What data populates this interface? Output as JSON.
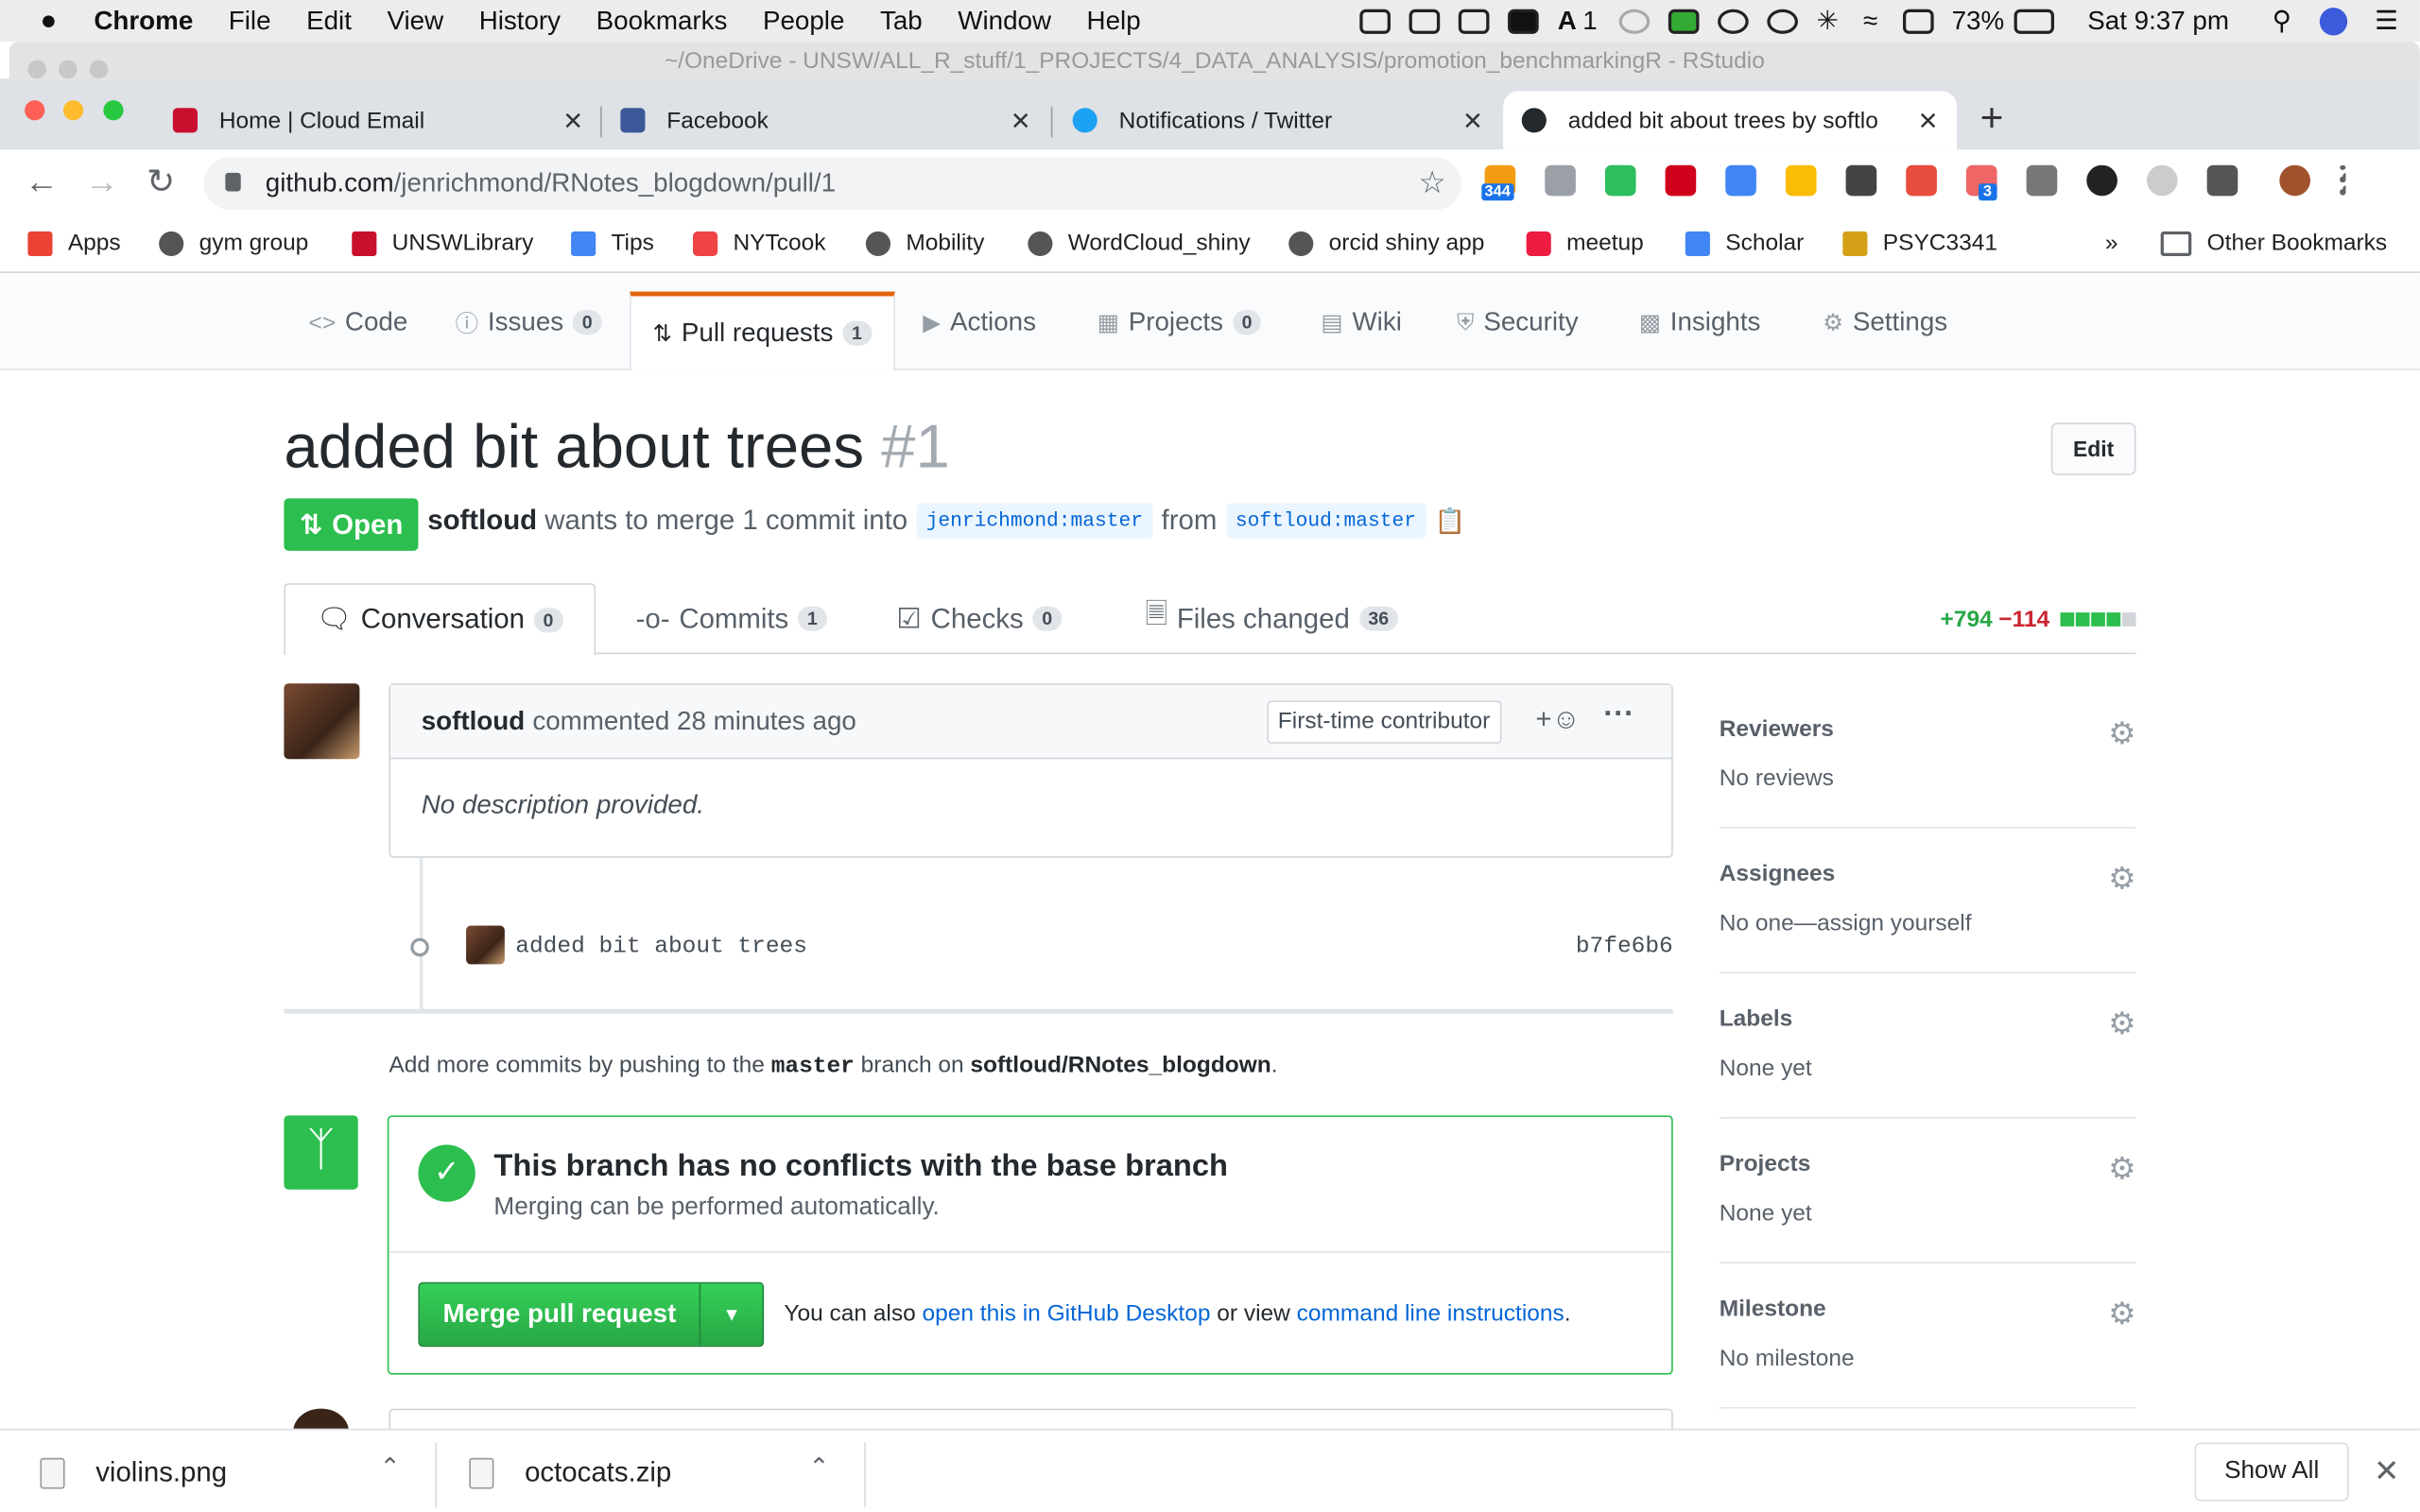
{
  "menubar": {
    "items": [
      "Chrome",
      "File",
      "Edit",
      "View",
      "History",
      "Bookmarks",
      "People",
      "Tab",
      "Window",
      "Help"
    ],
    "battery": "73%",
    "clock": "Sat 9:37 pm",
    "adobe_count": "1"
  },
  "background_window_title": "~/OneDrive - UNSW/ALL_R_stuff/1_PROJECTS/4_DATA_ANALYSIS/promotion_benchmarkingR - RStudio",
  "tabs": [
    {
      "title": "Home | Cloud Email",
      "icon": "unsw-icon"
    },
    {
      "title": "Facebook",
      "icon": "facebook-icon"
    },
    {
      "title": "Notifications / Twitter",
      "icon": "twitter-icon"
    },
    {
      "title": "added bit about trees by softlo",
      "icon": "github-icon"
    }
  ],
  "address": {
    "host": "github.com",
    "path": "/jenrichmond/RNotes_blogdown/pull/1"
  },
  "extensions": {
    "badge1": "344",
    "badge2": "3"
  },
  "bookmarks": [
    "Apps",
    "gym group",
    "UNSWLibrary",
    "Tips",
    "NYTcook",
    "Mobility",
    "WordCloud_shiny",
    "orcid shiny app",
    "meetup",
    "Scholar",
    "PSYC3341"
  ],
  "bookmarks_more": "»",
  "other_bookmarks": "Other Bookmarks",
  "reponav": [
    {
      "label": "Code",
      "count": ""
    },
    {
      "label": "Issues",
      "count": "0"
    },
    {
      "label": "Pull requests",
      "count": "1"
    },
    {
      "label": "Actions",
      "count": ""
    },
    {
      "label": "Projects",
      "count": "0"
    },
    {
      "label": "Wiki",
      "count": ""
    },
    {
      "label": "Security",
      "count": ""
    },
    {
      "label": "Insights",
      "count": ""
    },
    {
      "label": "Settings",
      "count": ""
    }
  ],
  "pr": {
    "title": "added bit about trees",
    "number": "#1",
    "edit_label": "Edit",
    "state": "Open",
    "author": "softloud",
    "meta_text": "wants to merge 1 commit into",
    "base_ref": "jenrichmond:master",
    "from_text": "from",
    "head_ref": "softloud:master"
  },
  "pr_tabs": [
    {
      "label": "Conversation",
      "count": "0"
    },
    {
      "label": "Commits",
      "count": "1"
    },
    {
      "label": "Checks",
      "count": "0"
    },
    {
      "label": "Files changed",
      "count": "36"
    }
  ],
  "diffstat": {
    "additions": "+794",
    "deletions": "−114"
  },
  "comment": {
    "author": "softloud",
    "action": "commented 28 minutes ago",
    "badge": "First-time contributor",
    "body": "No description provided."
  },
  "commit": {
    "message": "added bit about trees",
    "sha": "b7fe6b6"
  },
  "add_more": {
    "prefix": "Add more commits by pushing to the",
    "branch": "master",
    "middle": "branch on",
    "repo": "softloud/RNotes_blogdown",
    "suffix": "."
  },
  "merge": {
    "title": "This branch has no conflicts with the base branch",
    "subtitle": "Merging can be performed automatically.",
    "button": "Merge pull request",
    "also_prefix": "You can also",
    "link1": "open this in GitHub Desktop",
    "also_middle": "or view",
    "link2": "command line instructions",
    "also_suffix": "."
  },
  "sidebar": [
    {
      "heading": "Reviewers",
      "value": "No reviews"
    },
    {
      "heading": "Assignees",
      "value": "No one—assign yourself"
    },
    {
      "heading": "Labels",
      "value": "None yet"
    },
    {
      "heading": "Projects",
      "value": "None yet"
    },
    {
      "heading": "Milestone",
      "value": "No milestone"
    }
  ],
  "downloads": [
    {
      "name": "violins.png"
    },
    {
      "name": "octocats.zip"
    }
  ],
  "downloads_show_all": "Show All",
  "colors": {
    "accent_green": "#2cbe4e",
    "link_blue": "#0366d6",
    "tab_underline": "#e36209",
    "deletion_red": "#cb2431"
  }
}
